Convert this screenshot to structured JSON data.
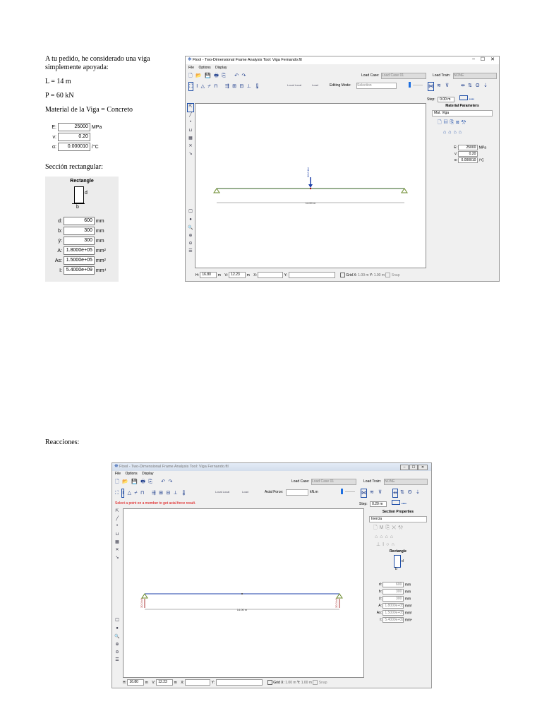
{
  "intro": {
    "line1": "A tu pedido, he considerado una viga",
    "line2": "simplemente apoyada:",
    "length": "L = 14 m",
    "load": "P = 60 kN",
    "material": "Material de la Viga = Concreto",
    "section": "Sección rectangular:"
  },
  "material_props": [
    {
      "label": "E:",
      "value": "25000",
      "unit": "MPa"
    },
    {
      "label": "ν:",
      "value": "0.20",
      "unit": ""
    },
    {
      "label": "α:",
      "value": "0.000010",
      "unit": "/°C"
    }
  ],
  "section_panel": {
    "title": "Rectangle",
    "d_label": "d",
    "b_label": "b",
    "rows": [
      {
        "label": "d:",
        "value": "600",
        "unit": "mm"
      },
      {
        "label": "b:",
        "value": "300",
        "unit": "mm"
      },
      {
        "label": "ȳ:",
        "value": "300",
        "unit": "mm"
      },
      {
        "label": "A:",
        "value": "1.8000e+05",
        "unit": "mm²"
      },
      {
        "label": "As:",
        "value": "1.5000e+05",
        "unit": "mm²"
      },
      {
        "label": "I:",
        "value": "5.4000e+09",
        "unit": "mm⁴"
      }
    ]
  },
  "reactions_heading": "Reacciones:",
  "window1": {
    "title": "Ftool - Two-Dimensional Frame Analysis Tool: Viga Fernando.ftl",
    "menu": [
      "File",
      "Options",
      "Display"
    ],
    "load_case_label": "Load Case:",
    "load_case_value": "Load Case 01",
    "load_train_label": "Load Train:",
    "load_train_value": "NONE",
    "local_global_1": "Local  Local",
    "local_global_2": "Load",
    "editing_mode_label": "Editing Mode:",
    "editing_mode_value": "Selection",
    "step_label": "Step:",
    "step_value": "0.00 m",
    "right_panel_title": "Material Parameters",
    "material_select": "Mat. Viga",
    "props": [
      {
        "label": "E:",
        "value": "25000",
        "unit": "MPa"
      },
      {
        "label": "ν:",
        "value": "0.20",
        "unit": ""
      },
      {
        "label": "α:",
        "value": "0.000010",
        "unit": "/°C"
      }
    ],
    "load_label": "60.0 kN",
    "span_label": "14.00 m",
    "status": {
      "h_label": "H:",
      "h_value": "16.80",
      "h_unit": "m",
      "v_label": "V:",
      "v_value": "12.23",
      "v_unit": "m",
      "x_label": "X:",
      "y_label": "Y:",
      "grid_label": "Grid",
      "gx_label": "X:",
      "gx_value": "1.00 m",
      "gy_label": "Y:",
      "gy_value": "1.00 m",
      "snap_label": "Snap"
    }
  },
  "window2": {
    "title": "Ftool - Two-Dimensional Frame Analysis Tool: Viga Fernando.ftl",
    "menu": [
      "File",
      "Options",
      "Display"
    ],
    "load_case_label": "Load Case:",
    "load_case_value": "Load Case 01",
    "load_train_label": "Load Train:",
    "load_train_value": "NONE",
    "axial_force_label": "Axial Force:",
    "axial_unit": "kN.m",
    "message": "Select a point on a member to get axial force result.",
    "step_label": "Step:",
    "step_value": "0.20 m",
    "right_panel_title": "Section Properties",
    "section_select": "Inercia",
    "shape_title": "Rectangle",
    "d_label": "d",
    "b_label": "b",
    "rows": [
      {
        "label": "d:",
        "value": "600",
        "unit": "mm"
      },
      {
        "label": "b:",
        "value": "300",
        "unit": "mm"
      },
      {
        "label": "ȳ:",
        "value": "300",
        "unit": "mm"
      },
      {
        "label": "A:",
        "value": "1.8000e+05",
        "unit": "mm²"
      },
      {
        "label": "As:",
        "value": "1.5000e+05",
        "unit": "mm²"
      },
      {
        "label": "I:",
        "value": "5.4000e+09",
        "unit": "mm⁴"
      }
    ],
    "reaction_left": "30.0 kN",
    "reaction_right": "30.0 kN",
    "span_label": "14.00 m",
    "status": {
      "h_label": "H:",
      "h_value": "16.80",
      "h_unit": "m",
      "v_label": "V:",
      "v_value": "12.23",
      "v_unit": "m",
      "x_label": "X:",
      "y_label": "Y:",
      "grid_label": "Grid",
      "gx_label": "X:",
      "gx_value": "1.00 m",
      "gy_label": "Y:",
      "gy_value": "1.00 m",
      "snap_label": "Snap"
    }
  },
  "colors": {
    "beam": "#2f5f1f",
    "load": "#1b3ea8",
    "accent": "#1e4ea8",
    "support": "#6a8a2a"
  }
}
